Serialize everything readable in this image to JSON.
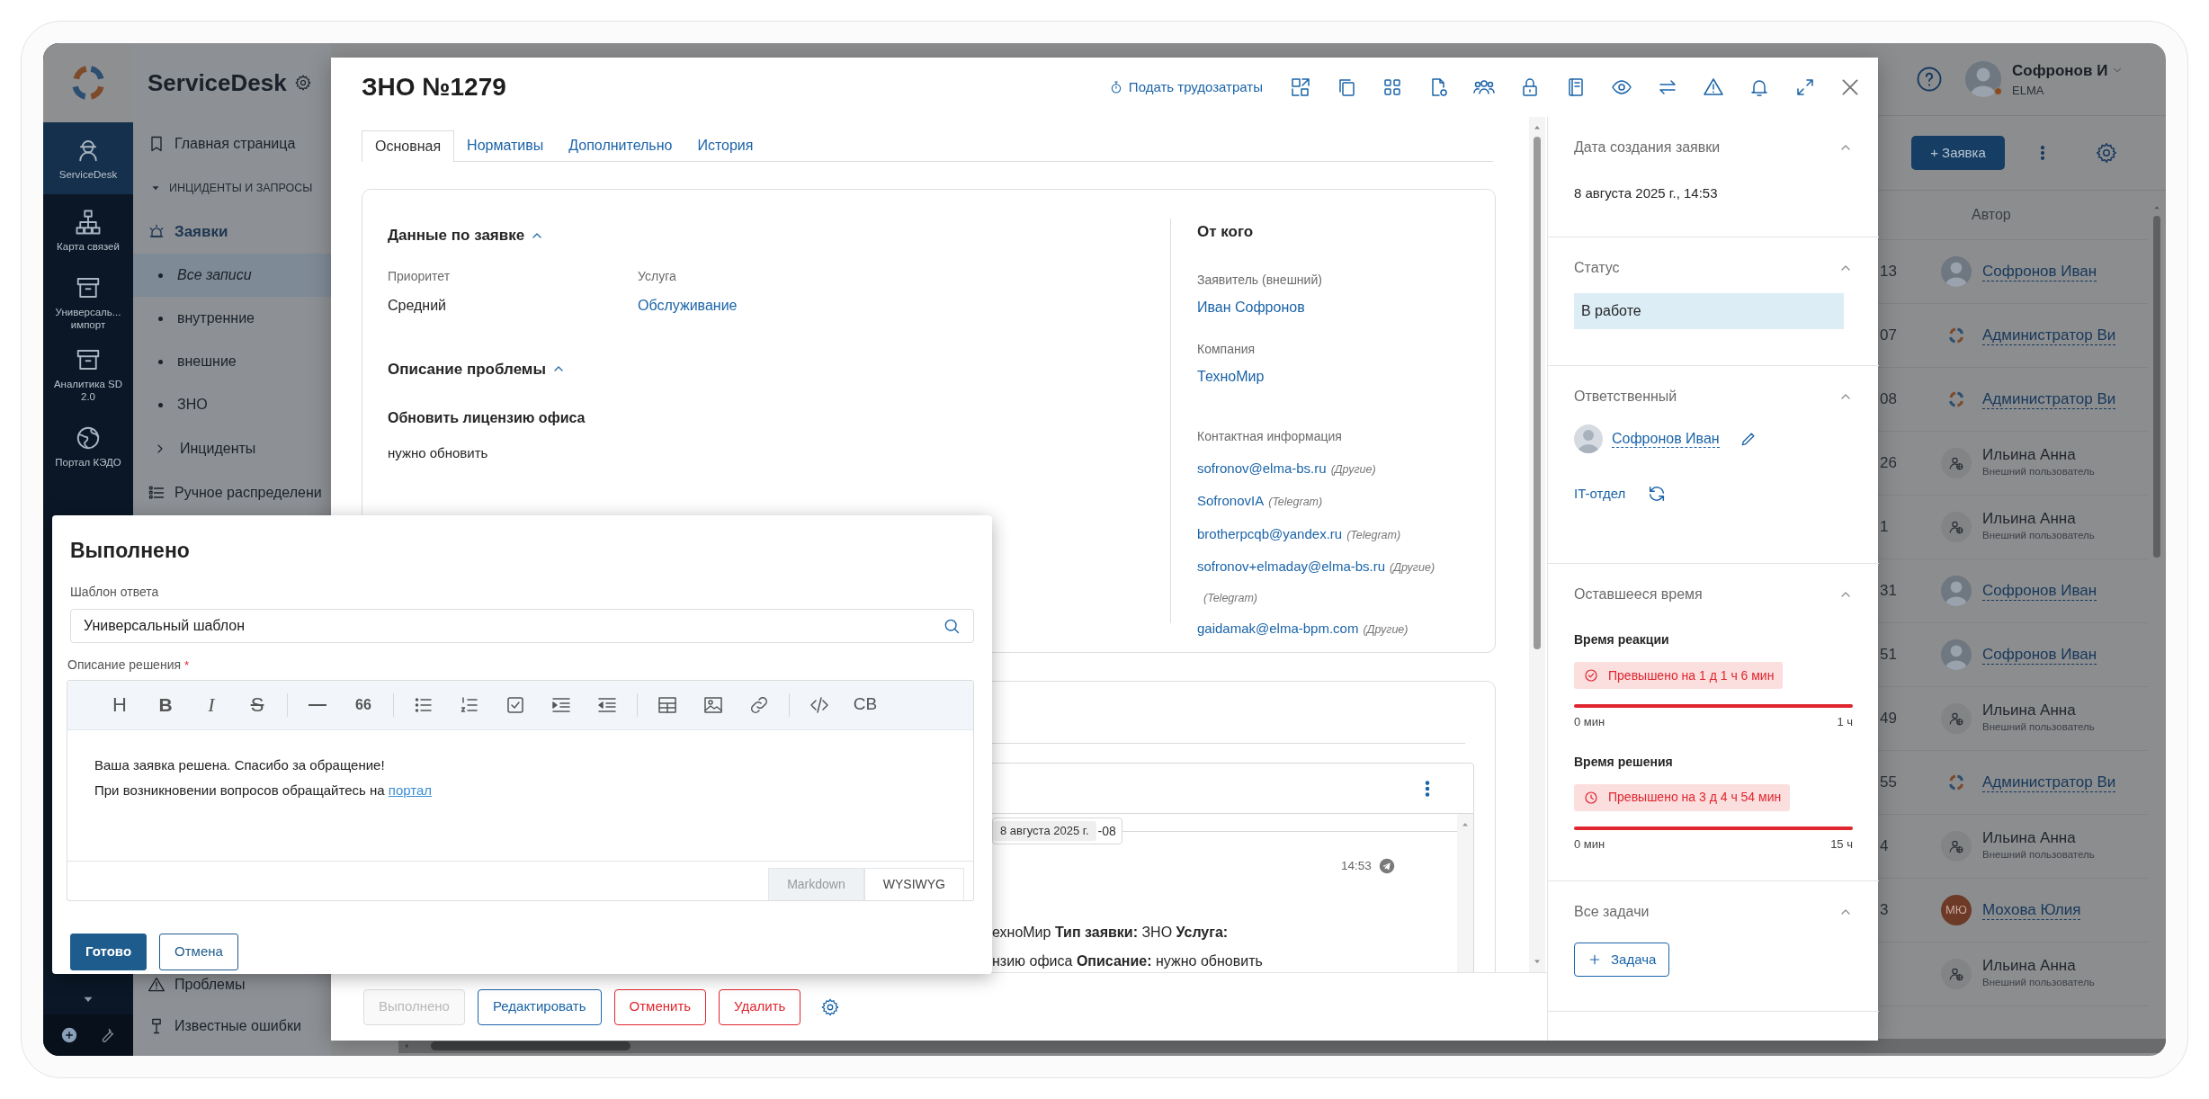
{
  "rail": {
    "items": [
      {
        "kind": "helmet",
        "label": "ServiceDesk",
        "selected": true
      },
      {
        "kind": "hierarchy",
        "label": "Карта связей",
        "selected": false
      },
      {
        "kind": "archive",
        "label": "Универсаль... импорт",
        "selected": false
      },
      {
        "kind": "archive",
        "label": "Аналитика SD 2.0",
        "selected": false
      },
      {
        "kind": "globe",
        "label": "Портал КЭДО",
        "selected": false
      }
    ]
  },
  "nav": {
    "title": "ServiceDesk",
    "items": [
      {
        "kind": "bookmark",
        "label": "Главная страница"
      },
      {
        "kind": "group",
        "label": "ИНЦИДЕНТЫ И ЗАПРОСЫ",
        "expanded": true,
        "children": [
          {
            "kind": "section",
            "label": "Заявки",
            "expanded": true,
            "children": [
              {
                "kind": "view",
                "label": "Все записи",
                "selected": true
              },
              {
                "kind": "view",
                "label": "внутренние",
                "selected": false
              },
              {
                "kind": "view",
                "label": "внешние",
                "selected": false
              },
              {
                "kind": "view",
                "label": "ЗНО",
                "selected": false
              },
              {
                "kind": "folder",
                "label": "Инциденты",
                "expanded": false,
                "selected": false
              }
            ]
          }
        ]
      },
      {
        "kind": "list",
        "label": "Ручное распределени"
      }
    ],
    "bottom_items": [
      {
        "kind": "warning",
        "label": "Проблемы"
      },
      {
        "kind": "pin",
        "label": "Известные ошибки"
      }
    ]
  },
  "list": {
    "user": {
      "name": "Софронов И",
      "org": "ELMA"
    },
    "create_button": "+ Заявка",
    "column": "Автор",
    "rows": [
      {
        "cell": "13",
        "author": "Софронов Иван",
        "kind": "photo"
      },
      {
        "cell": "07",
        "author": "Администратор Ви",
        "kind": "logo"
      },
      {
        "cell": "08",
        "author": "Администратор Ви",
        "kind": "logo"
      },
      {
        "cell": "26",
        "author": "Ильина Анна",
        "kind": "external",
        "subtitle": "Внешний пользователь"
      },
      {
        "cell": "1",
        "author": "Ильина Анна",
        "kind": "external",
        "subtitle": "Внешний пользователь"
      },
      {
        "cell": "31",
        "author": "Софронов Иван",
        "kind": "photo"
      },
      {
        "cell": "51",
        "author": "Софронов Иван",
        "kind": "photo"
      },
      {
        "cell": "49",
        "author": "Ильина Анна",
        "kind": "external",
        "subtitle": "Внешний пользователь"
      },
      {
        "cell": "55",
        "author": "Администратор Ви",
        "kind": "logo"
      },
      {
        "cell": "4",
        "author": "Ильина Анна",
        "kind": "external",
        "subtitle": "Внешний пользователь"
      },
      {
        "cell": "3",
        "author": "Мохова Юлия",
        "kind": "initials",
        "initials": "МЮ"
      },
      {
        "author": "Ильина Анна",
        "kind": "external",
        "subtitle": "Внешний пользователь"
      }
    ]
  },
  "ticket": {
    "title": "ЗНО №1279",
    "timesheet_link": "Подать трудозатраты",
    "tabs": [
      {
        "label": "Основная",
        "selected": true
      },
      {
        "label": "Нормативы",
        "selected": false
      },
      {
        "label": "Дополнительно",
        "selected": false
      },
      {
        "label": "История",
        "selected": false
      }
    ],
    "details": {
      "title": "Данные по заявке",
      "expanded": true,
      "fields": [
        {
          "label": "Приоритет",
          "value": "Средний",
          "kind": "text"
        },
        {
          "label": "Услуга",
          "value": "Обслуживание",
          "kind": "link"
        }
      ]
    },
    "problem": {
      "title": "Описание проблемы",
      "expanded": true,
      "subject": "Обновить лицензию офиса",
      "description": "нужно обновить"
    },
    "requester": {
      "title": "От кого",
      "fields": [
        {
          "label": "Заявитель (внешний)",
          "value": "Иван Софронов"
        },
        {
          "label": "Компания",
          "value": "ТехноМир"
        }
      ],
      "contacts_label": "Контактная информация",
      "contacts": [
        {
          "value": "sofronov@elma-bs.ru",
          "tag": "(Другие)"
        },
        {
          "value": "SofronovIA",
          "tag": "(Telegram)"
        },
        {
          "value": "brotherpcqb@yandex.ru",
          "tag": "(Telegram)"
        },
        {
          "value": "sofronov+elmaday@elma-bs.ru",
          "tag": "(Другие)"
        },
        {
          "tag": "(Telegram)"
        },
        {
          "value": "gaidamak@elma-bpm.com",
          "tag": "(Другие)"
        }
      ]
    },
    "conversation": {
      "date": "8 августа 2025 г.",
      "date_suffix": "-08",
      "time": "14:53",
      "lines": [
        "ехноМир **Тип заявки:** ЗНО **Услуга:**",
        "нзию офиса **Описание:** нужно обновить"
      ]
    },
    "actions": [
      {
        "label": "Выполнено",
        "kind": "neutral",
        "disabled": true
      },
      {
        "label": "Редактировать",
        "kind": "primary",
        "disabled": false
      },
      {
        "label": "Отменить",
        "kind": "danger",
        "disabled": false
      },
      {
        "label": "Удалить",
        "kind": "danger",
        "disabled": false
      }
    ],
    "side": [
      {
        "kind": "date",
        "title": "Дата создания заявки",
        "expanded": true,
        "value": "8 августа 2025 г., 14:53"
      },
      {
        "kind": "status",
        "title": "Статус",
        "expanded": true,
        "value": "В работе"
      },
      {
        "kind": "assignee",
        "title": "Ответственный",
        "expanded": true,
        "person": "Софронов Иван",
        "team": "IT-отдел"
      },
      {
        "kind": "timers",
        "title": "Оставшееся время",
        "expanded": true,
        "timers": [
          {
            "title": "Время реакции",
            "kind": "check",
            "badge": "Превышено на 1 д 1 ч 6 мин",
            "level": 1,
            "min": "0 мин",
            "max": "1 ч"
          },
          {
            "title": "Время решения",
            "kind": "clock",
            "badge": "Превышено на 3 д 4 ч 54 мин",
            "level": 1,
            "min": "0 мин",
            "max": "15 ч"
          }
        ]
      },
      {
        "kind": "tasks",
        "title": "Все задачи",
        "expanded": true,
        "button": "Задача"
      }
    ]
  },
  "dialog": {
    "title": "Выполнено",
    "template_label": "Шаблон ответа",
    "template_value": "Универсальный шаблон",
    "description_label": "Описание решения",
    "required_mark": "*",
    "toolbar": [
      {
        "kind": "heading",
        "label": "H"
      },
      {
        "kind": "bold",
        "label": "B"
      },
      {
        "kind": "italic",
        "label": "I"
      },
      {
        "kind": "strike",
        "label": "S"
      },
      {
        "kind": "separator"
      },
      {
        "kind": "rule"
      },
      {
        "kind": "quote",
        "label": "66"
      },
      {
        "kind": "separator"
      },
      {
        "kind": "bullets"
      },
      {
        "kind": "numbers"
      },
      {
        "kind": "task"
      },
      {
        "kind": "indent"
      },
      {
        "kind": "outdent"
      },
      {
        "kind": "separator"
      },
      {
        "kind": "table"
      },
      {
        "kind": "image"
      },
      {
        "kind": "link"
      },
      {
        "kind": "separator"
      },
      {
        "kind": "code"
      },
      {
        "kind": "cb",
        "label": "CB"
      }
    ],
    "content": [
      {
        "text": "Ваша заявка решена. Спасибо за обращение!"
      },
      {
        "text": "При возникновении вопросов обращайтесь на",
        "link": "портал"
      }
    ],
    "modes": [
      {
        "label": "Markdown",
        "selected": false
      },
      {
        "label": "WYSIWYG",
        "selected": true
      }
    ],
    "buttons": [
      {
        "label": "Готово",
        "kind": "primary"
      },
      {
        "label": "Отмена",
        "kind": "secondary"
      }
    ]
  }
}
